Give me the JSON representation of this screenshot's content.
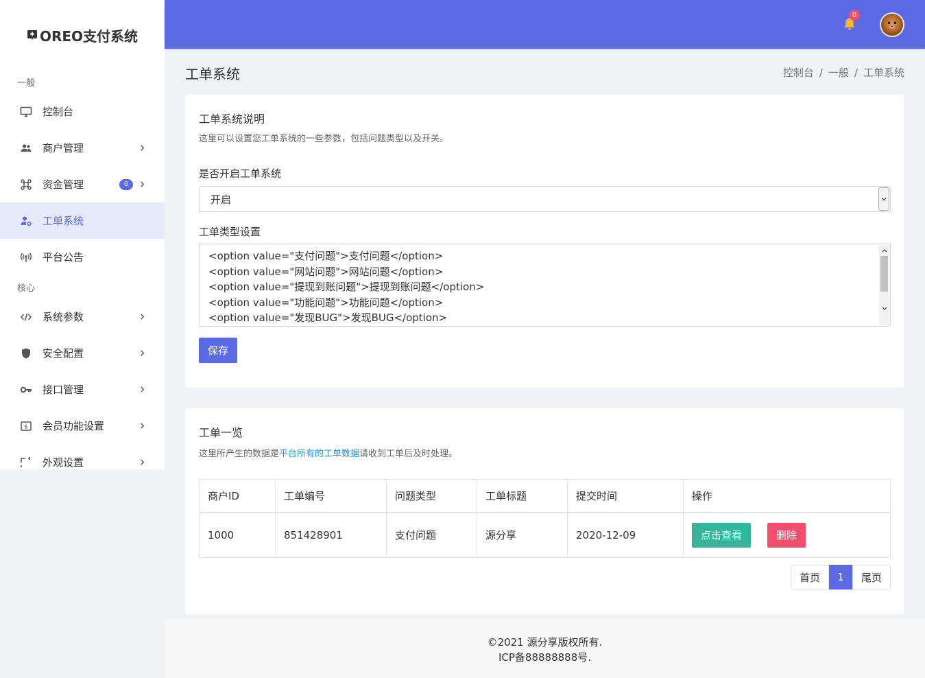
{
  "brand": {
    "name": "OREO支付系统"
  },
  "sidebar": {
    "section_general": "一般",
    "section_core": "核心",
    "items": [
      {
        "label": "控制台"
      },
      {
        "label": "商户管理"
      },
      {
        "label": "资金管理",
        "badge": "0"
      },
      {
        "label": "工单系统"
      },
      {
        "label": "平台公告"
      },
      {
        "label": "系统参数"
      },
      {
        "label": "安全配置"
      },
      {
        "label": "接口管理"
      },
      {
        "label": "会员功能设置"
      },
      {
        "label": "外观设置"
      }
    ]
  },
  "header": {
    "notification_count": "0",
    "accent": "#5b6ae3"
  },
  "page": {
    "title": "工单系统",
    "breadcrumb": [
      "控制台",
      "/",
      "一般",
      "/",
      "工单系统"
    ]
  },
  "settings_card": {
    "title": "工单系统说明",
    "subtitle": "这里可以设置您工单系统的一些参数，包括问题类型以及开关。",
    "enable_label": "是否开启工单系统",
    "enable_value": "开启",
    "types_label": "工单类型设置",
    "types_lines": [
      "<option value=\"支付问题\">支付问题</option>",
      "<option value=\"网站问题\">网站问题</option>",
      "<option value=\"提现到账问题\">提现到账问题</option>",
      "<option value=\"功能问题\">功能问题</option>",
      "<option value=\"发现BUG\">发现BUG</option>"
    ],
    "save_label": "保存"
  },
  "list_card": {
    "title": "工单一览",
    "subtitle_prefix": "这里所产生的数据是",
    "subtitle_link": "平台所有的工单数据",
    "subtitle_suffix": "请收到工单后及时处理。",
    "columns": [
      "商户ID",
      "工单编号",
      "问题类型",
      "工单标题",
      "提交时间",
      "操作"
    ],
    "rows": [
      {
        "merchant_id": "1000",
        "ticket_no": "851428901",
        "type": "支付问题",
        "title": "源分享",
        "time": "2020-12-09",
        "view_label": "点击查看",
        "delete_label": "删除"
      }
    ],
    "pager": {
      "first": "首页",
      "current": "1",
      "last": "尾页"
    }
  },
  "footer": {
    "line1": "©2021 源分享版权所有.",
    "line2": "ICP备88888888号."
  }
}
